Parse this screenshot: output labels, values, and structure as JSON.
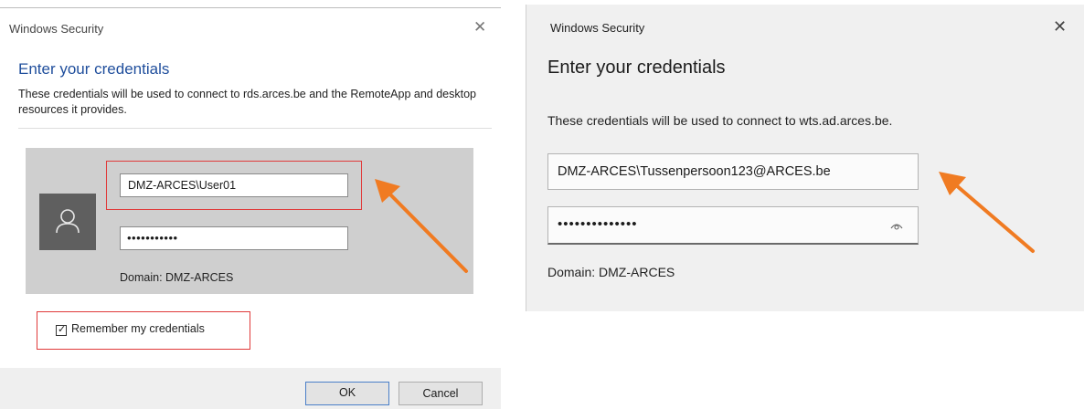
{
  "left_dialog": {
    "window_title": "Windows Security",
    "close_glyph": "✕",
    "heading": "Enter your credentials",
    "description": "These credentials will be used to connect to rds.arces.be and the RemoteApp and desktop resources it provides.",
    "username_value": "DMZ-ARCES\\User01",
    "password_mask": "•••••••••••",
    "domain_text": "Domain: DMZ-ARCES",
    "remember_label": "Remember my credentials",
    "remember_checked": true,
    "check_glyph": "✓",
    "ok_label": "OK",
    "cancel_label": "Cancel"
  },
  "right_dialog": {
    "window_title": "Windows Security",
    "close_glyph": "✕",
    "heading": "Enter your credentials",
    "description": "These credentials will be used to connect to wts.ad.arces.be.",
    "username_value": "DMZ-ARCES\\Tussenpersoon123@ARCES.be",
    "password_mask": "••••••••••••••",
    "domain_text": "Domain: DMZ-ARCES"
  },
  "colors": {
    "highlight_box": "#e03a3a",
    "annotation_arrow": "#f07b22",
    "left_heading": "#1f4e9c"
  },
  "icons": {
    "avatar": "user-icon",
    "reveal": "eye-icon"
  }
}
